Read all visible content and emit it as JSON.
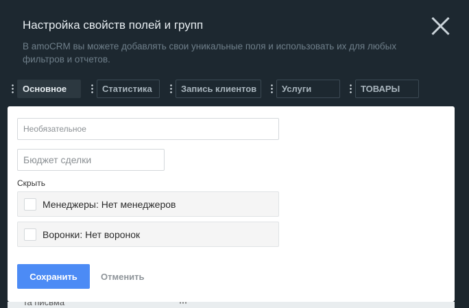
{
  "header": {
    "title": "Настройка свойств полей и групп",
    "subtitle": "В amoCRM вы можете добавлять свои уникальные поля и использовать их для любых фильтров и отчетов."
  },
  "tabs": [
    {
      "label": "Основное",
      "active": true
    },
    {
      "label": "Статистика",
      "active": false
    },
    {
      "label": "Запись клиентов",
      "active": false
    },
    {
      "label": "Услуги",
      "active": false
    },
    {
      "label": "ТОВАРЫ",
      "active": false
    }
  ],
  "form": {
    "optional_placeholder": "Необязательное",
    "field_name_placeholder": "Бюджет сделки",
    "hide_label": "Скрыть",
    "options": [
      {
        "label": "Менеджеры: Нет менеджеров",
        "checked": false
      },
      {
        "label": "Воронки: Нет воронок",
        "checked": false
      }
    ],
    "save_label": "Сохранить",
    "cancel_label": "Отменить"
  },
  "background_row": {
    "text": "Ta писвма"
  },
  "colors": {
    "accent": "#4c8bf5",
    "header_bg": "#1d2830"
  }
}
